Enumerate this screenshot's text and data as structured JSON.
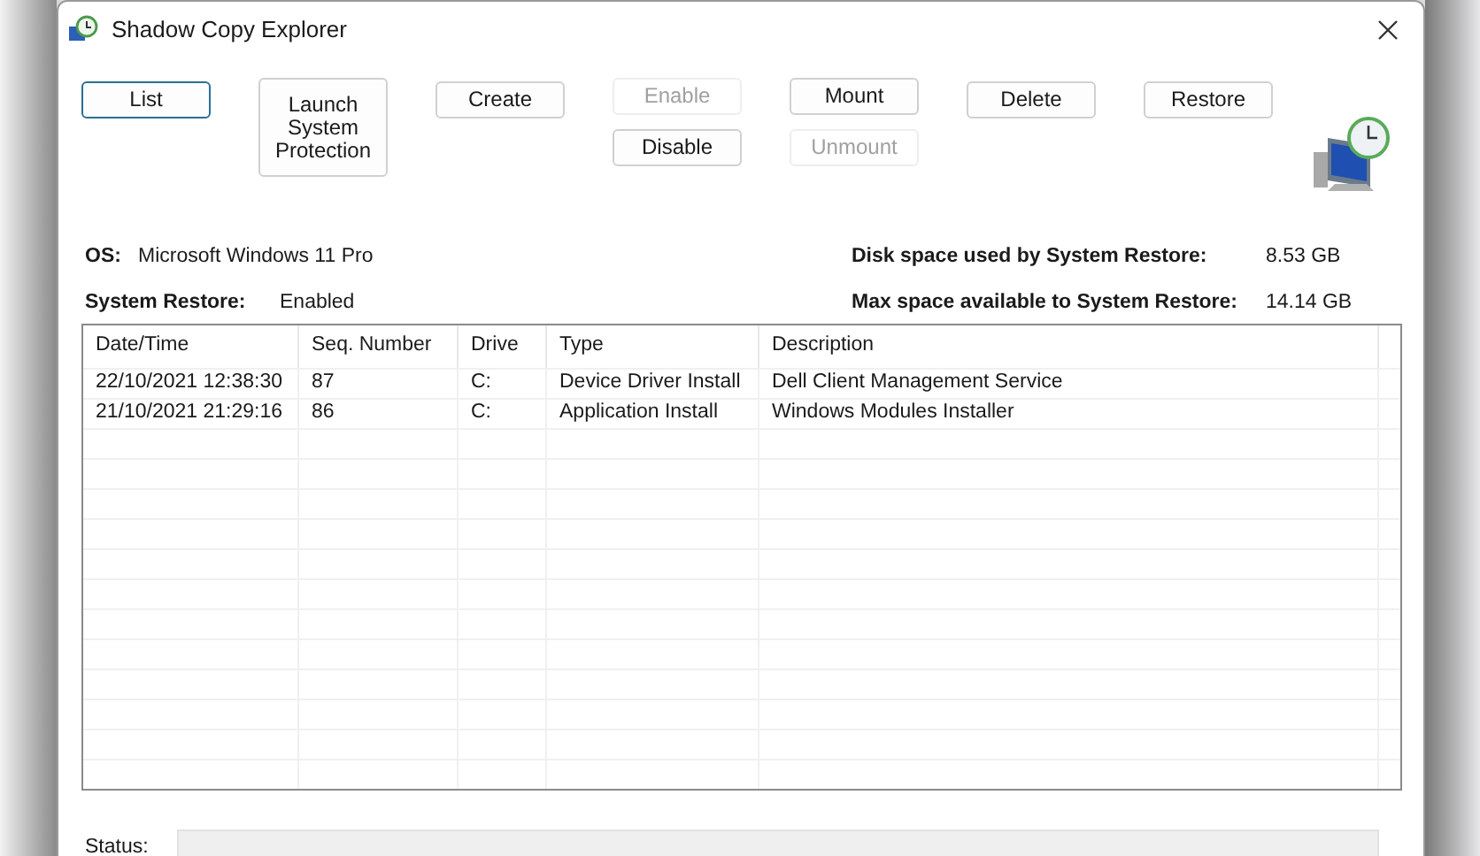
{
  "window": {
    "title": "Shadow Copy Explorer"
  },
  "buttons": [
    {
      "label": "List",
      "disabled": false,
      "focused": true
    },
    {
      "label": "Launch System Protection",
      "disabled": false,
      "focused": false
    },
    {
      "label": "Create",
      "disabled": false,
      "focused": false
    },
    {
      "label": "Enable",
      "disabled": true,
      "focused": false
    },
    {
      "label": "Mount",
      "disabled": false,
      "focused": false
    },
    {
      "label": "Delete",
      "disabled": false,
      "focused": false
    },
    {
      "label": "Restore",
      "disabled": false,
      "focused": false
    },
    {
      "label": "Disable",
      "disabled": false,
      "focused": false
    },
    {
      "label": "Unmount",
      "disabled": true,
      "focused": false
    }
  ],
  "info_left": [
    {
      "label": "OS:",
      "value": "Microsoft Windows 11 Pro"
    },
    {
      "label": "System Restore:",
      "value": "Enabled"
    }
  ],
  "info_right": [
    {
      "label": "Disk space used by System Restore:",
      "value": "8.53 GB"
    },
    {
      "label": "Max space available to System Restore:",
      "value": "14.14 GB"
    }
  ],
  "table": {
    "columns": [
      "Date/Time",
      "Seq. Number",
      "Drive",
      "Type",
      "Description"
    ],
    "rows": [
      [
        "22/10/2021 12:38:30",
        "87",
        "C:",
        "Device Driver Install",
        "Dell Client Management Service"
      ],
      [
        "21/10/2021 21:29:16",
        "86",
        "C:",
        "Application Install",
        "Windows Modules Installer"
      ]
    ]
  },
  "status_bar": {
    "label": "Status:"
  }
}
